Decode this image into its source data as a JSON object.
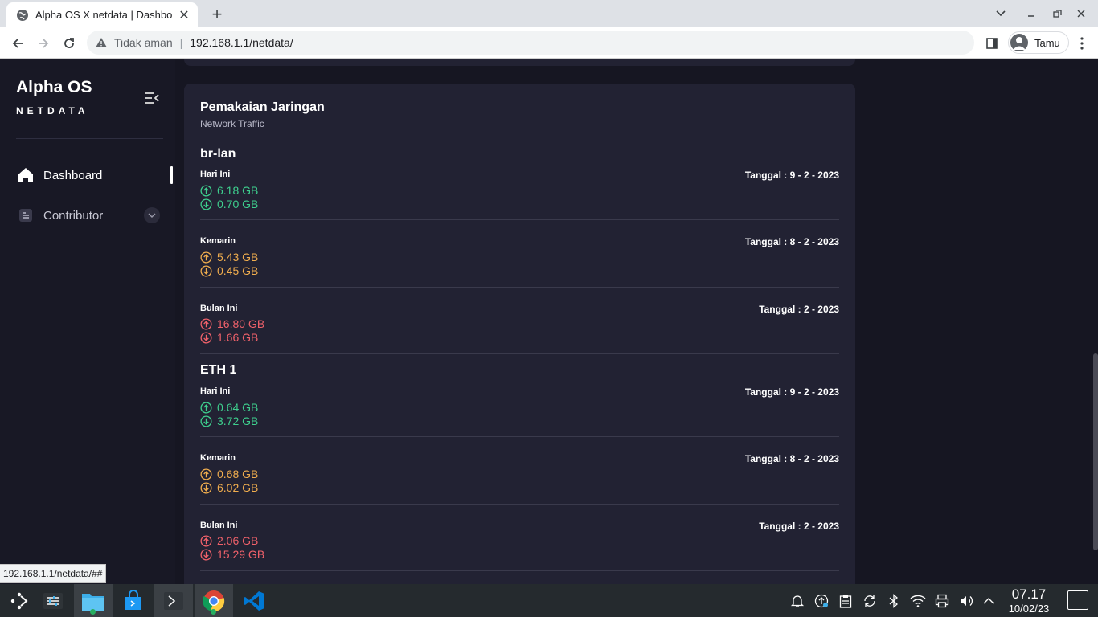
{
  "browser": {
    "tab_title": "Alpha OS X netdata | Dashbo",
    "security_label": "Tidak aman",
    "url": "192.168.1.1/netdata/",
    "profile_name": "Tamu",
    "status_url": "192.168.1.1/netdata/##"
  },
  "sidebar": {
    "brand_title": "Alpha OS",
    "brand_subtitle": "NETDATA",
    "items": [
      {
        "label": "Dashboard",
        "icon": "home-icon",
        "active": true
      },
      {
        "label": "Contributor",
        "icon": "document-icon",
        "active": false
      }
    ]
  },
  "card": {
    "title": "Pemakaian Jaringan",
    "subtitle": "Network Traffic",
    "interfaces": [
      {
        "name": "br-lan",
        "rows": [
          {
            "period": "Hari Ini",
            "date": "Tanggal : 9 - 2 - 2023",
            "up": "6.18 GB",
            "down": "0.70 GB",
            "color": "#3ecf8e"
          },
          {
            "period": "Kemarin",
            "date": "Tanggal : 8 - 2 - 2023",
            "up": "5.43 GB",
            "down": "0.45 GB",
            "color": "#f0ad4e"
          },
          {
            "period": "Bulan Ini",
            "date": "Tanggal : 2 - 2023",
            "up": "16.80 GB",
            "down": "1.66 GB",
            "color": "#f0616a"
          }
        ]
      },
      {
        "name": "ETH 1",
        "rows": [
          {
            "period": "Hari Ini",
            "date": "Tanggal : 9 - 2 - 2023",
            "up": "0.64 GB",
            "down": "3.72 GB",
            "color": "#3ecf8e"
          },
          {
            "period": "Kemarin",
            "date": "Tanggal : 8 - 2 - 2023",
            "up": "0.68 GB",
            "down": "6.02 GB",
            "color": "#f0ad4e"
          },
          {
            "period": "Bulan Ini",
            "date": "Tanggal : 2 - 2023",
            "up": "2.06 GB",
            "down": "15.29 GB",
            "color": "#f0616a"
          }
        ]
      }
    ]
  },
  "taskbar": {
    "time": "07.17",
    "date": "10/02/23",
    "apps": [
      "launcher-icon",
      "settings-icon",
      "file-manager-icon",
      "store-icon",
      "terminal-icon",
      "chrome-icon",
      "vscode-icon"
    ]
  },
  "colors": {
    "today": "#3ecf8e",
    "yesterday": "#f0ad4e",
    "month": "#f0616a",
    "card_bg": "#222233"
  }
}
